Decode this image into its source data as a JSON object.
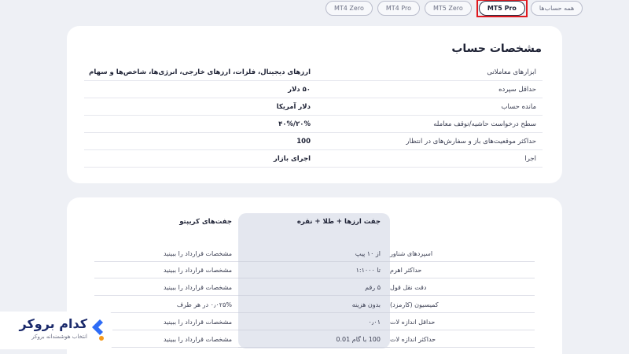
{
  "tabs": [
    {
      "label": "MT4 Zero"
    },
    {
      "label": "MT4 Pro"
    },
    {
      "label": "MT5 Zero"
    },
    {
      "label": "MT5 Pro"
    },
    {
      "label": "همه حساب‌ها"
    }
  ],
  "account": {
    "title": "مشخصات حساب",
    "rows": [
      {
        "label": "ابزارهای معاملاتی",
        "value": "ارزهای دیجیتال، فلزات، ارزهای خارجی، انرژی‌ها، شاخص‌ها و سهام"
      },
      {
        "label": "حداقل سپرده",
        "value": "۵۰ دلار"
      },
      {
        "label": "مانده حساب",
        "value": "دلار آمریکا"
      },
      {
        "label": "سطح درخواست حاشیه/توقف معامله",
        "value": "۲۰%/۴۰%"
      },
      {
        "label": "حداکثر موقعیت‌های باز و سفارش‌های در انتظار",
        "value": "100"
      },
      {
        "label": "اجرا",
        "value": "اجرای بازار"
      }
    ]
  },
  "spec": {
    "header_mid": "جفت ارزها + طلا + نقره",
    "header_crypto": "جفت‌های کریپتو",
    "rows": [
      {
        "label": "اسپردهای شناور",
        "mid": "از ۱۰ پیپ",
        "crypto": "مشخصات قرارداد را ببینید"
      },
      {
        "label": "حداکثر اهرم",
        "mid": "تا ۱:۱۰۰۰",
        "crypto": "مشخصات قرارداد را ببینید"
      },
      {
        "label": "دقت نقل قول",
        "mid": "۵ رقم",
        "crypto": "مشخصات قرارداد را ببینید"
      },
      {
        "label": "کمیسیون (کارمزد)",
        "mid": "بدون هزینه",
        "crypto": "۰٫۰۲۵% در هر طرف"
      },
      {
        "label": "حداقل اندازه لات",
        "mid": "۰٫۰۱",
        "crypto": "مشخصات قرارداد را ببینید"
      },
      {
        "label": "حداکثر اندازه لات",
        "mid": "100 با گام 0.01",
        "crypto": "مشخصات قرارداد را ببینید"
      }
    ]
  },
  "logo": {
    "name": "کدام بروکر",
    "tagline": "انتخاب هوشمندانه بروکر",
    "colors": {
      "navy": "#1b2a6b",
      "blue": "#2e6cf6",
      "orange": "#f59a1b"
    }
  }
}
